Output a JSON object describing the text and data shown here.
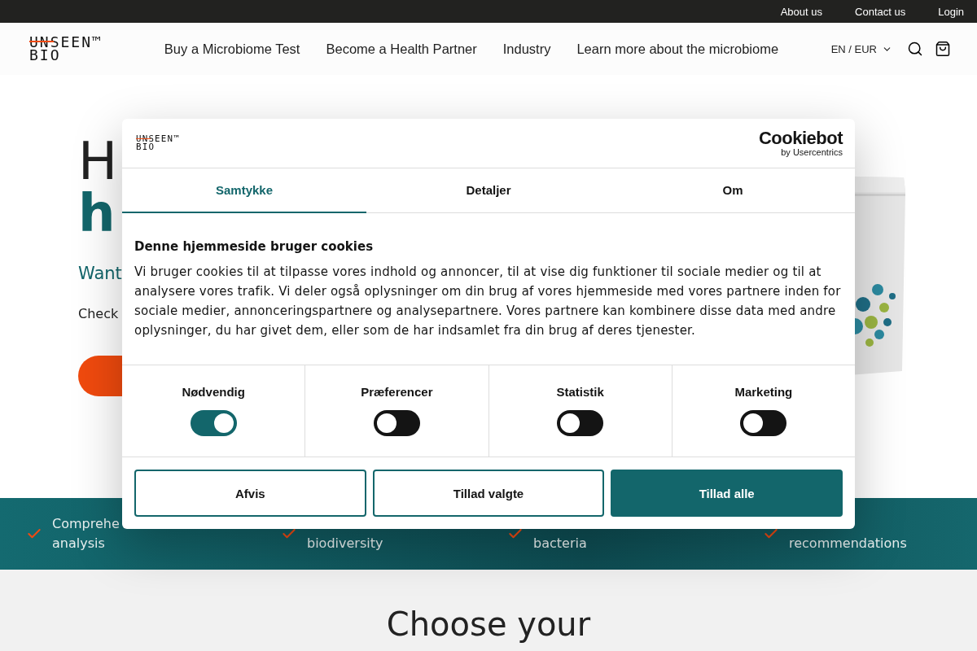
{
  "top_bar": {
    "links": [
      "About us",
      "Contact us",
      "Login"
    ]
  },
  "header": {
    "logo": [
      "UNSEEN™",
      "BIO"
    ],
    "nav": [
      "Buy a Microbiome Test",
      "Become a Health Partner",
      "Industry",
      "Learn more about the microbiome"
    ],
    "locale": "EN / EUR"
  },
  "hero": {
    "title_line_1": "H",
    "title_line_2": "h",
    "subtitle": "Want",
    "text": "Check"
  },
  "features": [
    {
      "lines": [
        "Comprehe",
        "analysis"
      ]
    },
    {
      "lines": [
        "biodiversity"
      ]
    },
    {
      "lines": [
        "bacteria"
      ]
    },
    {
      "lines": [
        "recommendations"
      ]
    }
  ],
  "section_title": "Choose your",
  "cookie_dialog": {
    "logo": [
      "UNSEEN™",
      "BIO"
    ],
    "provider": "Cookiebot",
    "provider_sub": "by Usercentrics",
    "tabs": [
      {
        "label": "Samtykke",
        "selected": true
      },
      {
        "label": "Detaljer",
        "selected": false
      },
      {
        "label": "Om",
        "selected": false
      }
    ],
    "heading": "Denne hjemmeside bruger cookies",
    "body": "Vi bruger cookies til at tilpasse vores indhold og annoncer, til at vise dig funktioner til sociale medier og til at analysere vores trafik. Vi deler også oplysninger om din brug af vores hjemmeside med vores partnere inden for sociale medier, annonceringspartnere og analysepartnere. Vores partnere kan kombinere disse data med andre oplysninger, du har givet dem, eller som de har indsamlet fra din brug af deres tjenester.",
    "categories": [
      {
        "label": "Nødvendig",
        "on": true
      },
      {
        "label": "Præferencer",
        "on": false
      },
      {
        "label": "Statistik",
        "on": false
      },
      {
        "label": "Marketing",
        "on": false
      }
    ],
    "buttons": [
      {
        "label": "Afvis",
        "kind": "outline"
      },
      {
        "label": "Tillad valgte",
        "kind": "outline"
      },
      {
        "label": "Tillad alle",
        "kind": "filled"
      }
    ]
  }
}
